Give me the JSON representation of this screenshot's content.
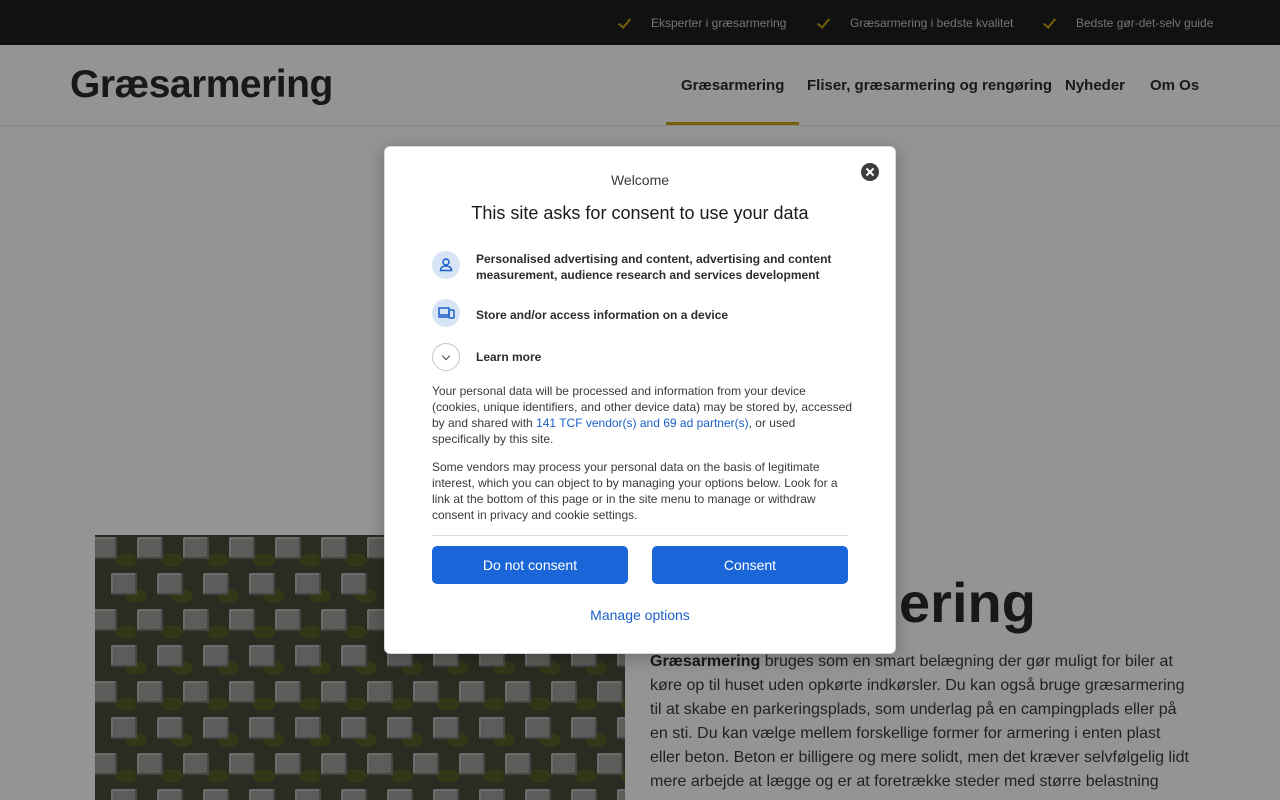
{
  "topbar": {
    "features": [
      "Eksperter i græsarmering",
      "Græsarmering i bedste kvalitet",
      "Bedste gør-det-selv guide"
    ]
  },
  "header": {
    "logo": "Græsarmering",
    "nav": [
      "Græsarmering",
      "Fliser, græsarmering og rengøring",
      "Nyheder",
      "Om Os"
    ],
    "active_nav": "Græsarmering"
  },
  "article": {
    "heading": "Græsarmering",
    "lead_bold": "Græsarmering",
    "paragraph": " bruges som en smart belægning der gør muligt for biler at køre op til huset uden opkørte indkørsler. Du kan også bruge græsarmering til at skabe en parkeringsplads, som underlag på en campingplads eller på en sti. Du kan vælge mellem forskellige former for armering i enten plast eller beton. Beton er billigere og mere solidt, men det kræver selvfølgelig lidt mere arbejde at lægge og er at foretrække steder med større belastning som"
  },
  "consent": {
    "welcome": "Welcome",
    "title": "This site asks for consent to use your data",
    "purposes": [
      {
        "icon": "person-icon",
        "label": "Personalised advertising and content, advertising and content measurement, audience research and services development"
      },
      {
        "icon": "devices-icon",
        "label": "Store and/or access information on a device"
      }
    ],
    "learn_more": "Learn more",
    "para1_before": "Your personal data will be processed and information from your device (cookies, unique identifiers, and other device data) may be stored by, accessed by and shared with ",
    "para1_link": "141 TCF vendor(s) and 69 ad partner(s)",
    "para1_after": ", or used specifically by this site.",
    "para2": "Some vendors may process your personal data on the basis of legitimate interest, which you can object to by managing your options below. Look for a link at the bottom of this page or in the site menu to manage or withdraw consent in privacy and cookie settings.",
    "do_not_consent": "Do not consent",
    "consent": "Consent",
    "manage_options": "Manage options"
  },
  "colors": {
    "accent": "#c8a20f",
    "button": "#1a66d8",
    "link": "#1a5fc8",
    "topbar": "#1e1e1e"
  }
}
